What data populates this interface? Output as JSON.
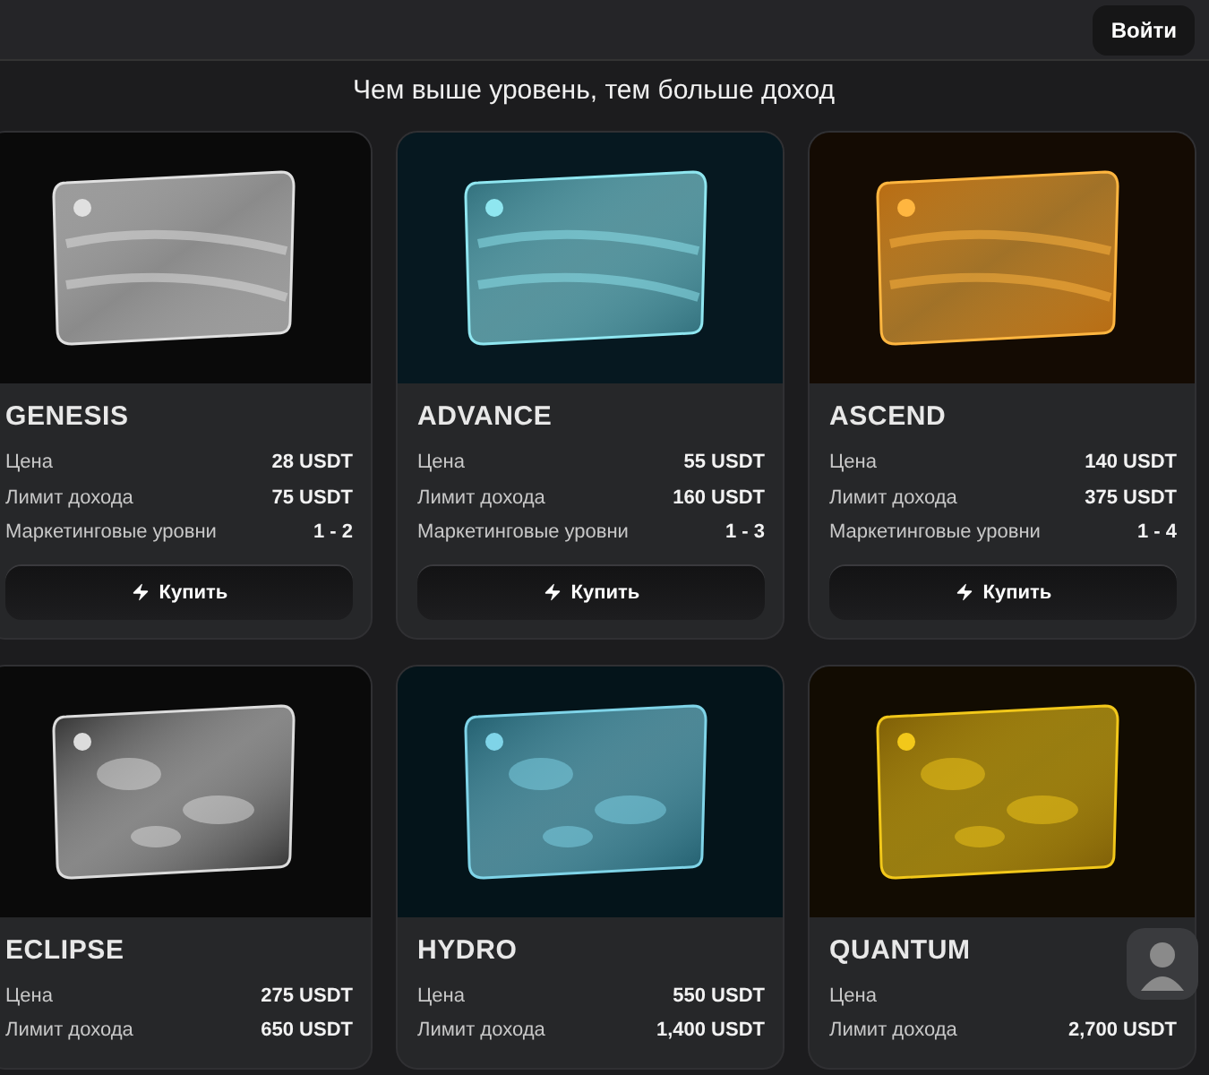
{
  "header": {
    "login_button": "Войти"
  },
  "title": "Чем выше уровень, тем больше доход",
  "plans": [
    {
      "name": "GENESIS",
      "kind": "silver-wave",
      "rows": [
        {
          "label": "Цена",
          "value": "28 USDT"
        },
        {
          "label": "Лимит дохода",
          "value": "75 USDT"
        },
        {
          "label": "Маркетинговые уровни",
          "value": "1 - 2"
        }
      ],
      "button": "Купить"
    },
    {
      "name": "ADVANCE",
      "kind": "teal-wave",
      "rows": [
        {
          "label": "Цена",
          "value": "55 USDT"
        },
        {
          "label": "Лимит дохода",
          "value": "160 USDT"
        },
        {
          "label": "Маркетинговые уровни",
          "value": "1 - 3"
        }
      ],
      "button": "Купить"
    },
    {
      "name": "ASCEND",
      "kind": "gold-wave",
      "rows": [
        {
          "label": "Цена",
          "value": "140 USDT"
        },
        {
          "label": "Лимит дохода",
          "value": "375 USDT"
        },
        {
          "label": "Маркетинговые уровни",
          "value": "1 - 4"
        }
      ],
      "button": "Купить"
    },
    {
      "name": "ECLIPSE",
      "kind": "chrome-liquid",
      "rows": [
        {
          "label": "Цена",
          "value": "275 USDT"
        },
        {
          "label": "Лимит дохода",
          "value": "650 USDT"
        }
      ]
    },
    {
      "name": "HYDRO",
      "kind": "aqua-liquid",
      "rows": [
        {
          "label": "Цена",
          "value": "550 USDT"
        },
        {
          "label": "Лимит дохода",
          "value": "1,400 USDT"
        }
      ]
    },
    {
      "name": "QUANTUM",
      "kind": "gold-liquid",
      "rows": [
        {
          "label": "Цена"
        },
        {
          "label": "Лимит дохода",
          "value": "2,700 USDT"
        }
      ]
    }
  ],
  "chat_avatar": {
    "shown": true
  }
}
